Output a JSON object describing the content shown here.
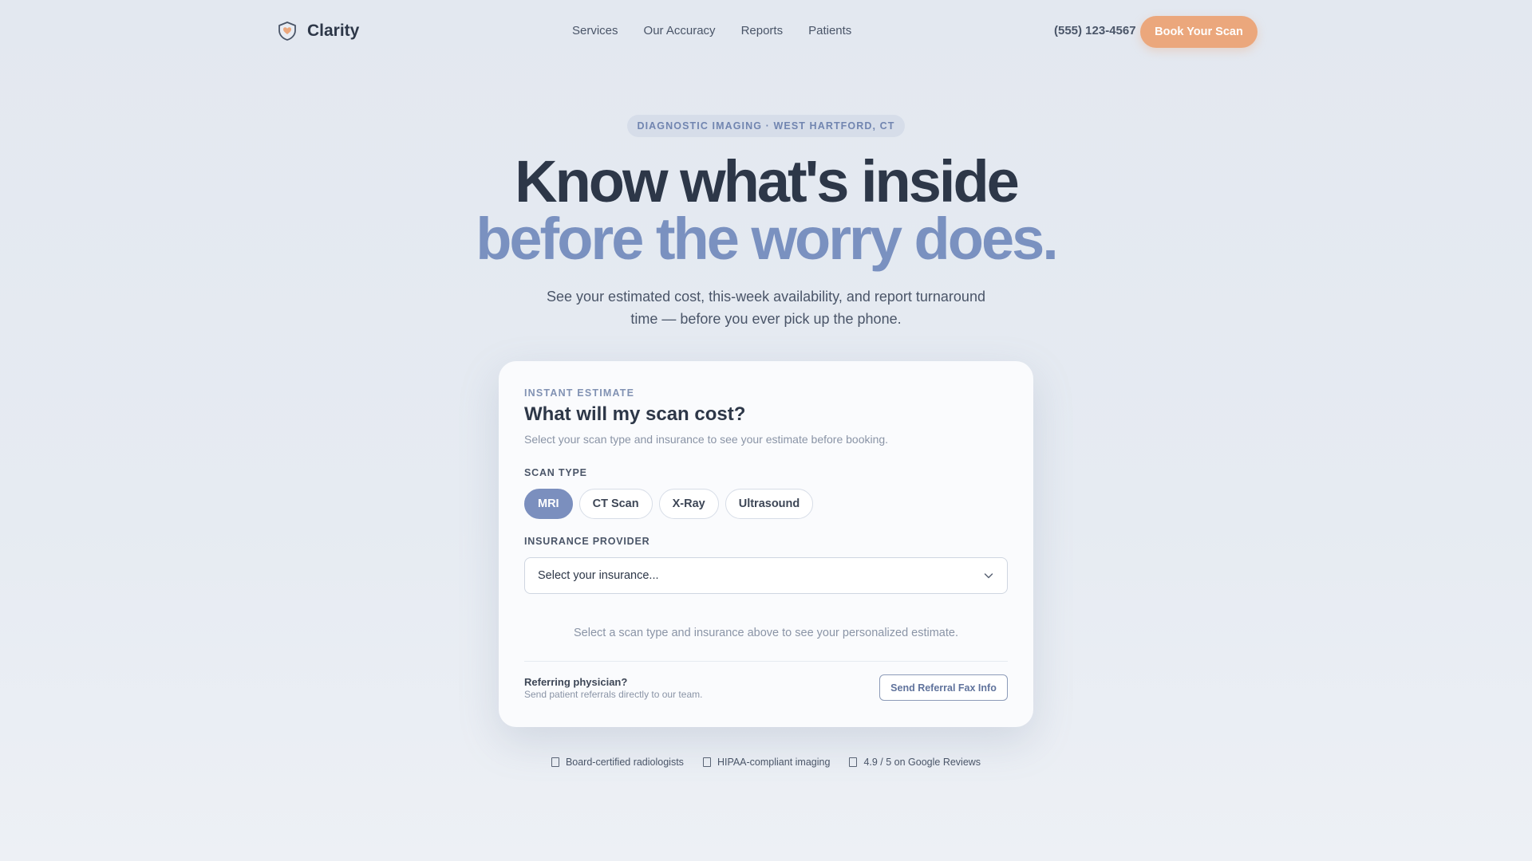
{
  "brand": {
    "name": "Clarity",
    "logo_icon": "shield-heart-icon",
    "accent_color": "#7b8fbe",
    "cta_color": "#eba77c"
  },
  "nav": {
    "items": [
      "Services",
      "Our Accuracy",
      "Reports",
      "Patients"
    ]
  },
  "header": {
    "phone": "(555) 123-4567",
    "cta_label": "Book Your Scan"
  },
  "hero": {
    "badge": "DIAGNOSTIC IMAGING · WEST HARTFORD, CT",
    "title_line1": "Know what's inside",
    "title_line2": "before the worry does.",
    "subtitle_line1": "See your estimated cost, this-week availability, and report turnaround",
    "subtitle_line2": "time — before you ever pick up the phone."
  },
  "estimate": {
    "eyebrow": "INSTANT ESTIMATE",
    "title": "What will my scan cost?",
    "description": "Select your scan type and insurance to see your estimate before booking.",
    "scan_type_label": "SCAN TYPE",
    "scan_types": [
      "MRI",
      "CT Scan",
      "X-Ray",
      "Ultrasound"
    ],
    "selected_scan_type": "MRI",
    "insurance_label": "INSURANCE PROVIDER",
    "insurance_value": "Select your insurance...",
    "dropdown_icon": "chevron-down-icon",
    "hint": "Select a scan type and insurance above to see your personalized estimate."
  },
  "referral": {
    "title": "Referring physician?",
    "description": "Send patient referrals directly to our team.",
    "button_label": "Send Referral Fax Info"
  },
  "trust": {
    "items": [
      "Board-certified radiologists",
      "HIPAA-compliant imaging",
      "4.9 / 5 on Google Reviews"
    ]
  }
}
